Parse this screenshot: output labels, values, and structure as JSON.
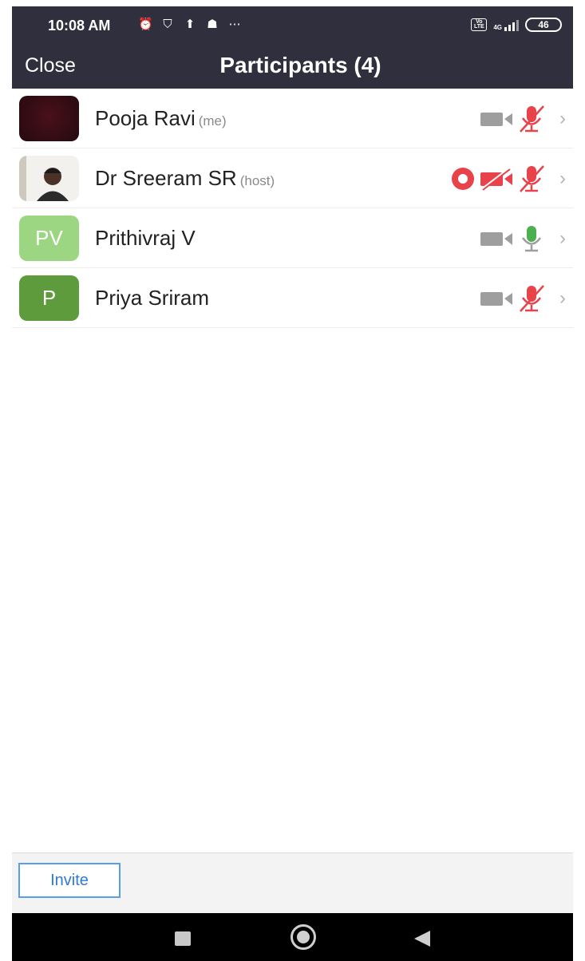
{
  "status": {
    "time": "10:08 AM",
    "volte": "Vo LTE",
    "network": "4G",
    "battery": "46"
  },
  "header": {
    "close_label": "Close",
    "title": "Participants (4)"
  },
  "participants": [
    {
      "name": "Pooja Ravi",
      "role": "(me)",
      "avatar_initials": "",
      "avatar_color": "#3a0d15",
      "video": "off",
      "mic": "muted",
      "recording": false
    },
    {
      "name": "Dr Sreeram SR",
      "role": "(host)",
      "avatar_initials": "",
      "avatar_color": "#d8d2c8",
      "video": "disabled",
      "mic": "muted",
      "recording": true
    },
    {
      "name": "Prithivraj V",
      "role": "",
      "avatar_initials": "PV",
      "avatar_color": "#9dd683",
      "video": "off",
      "mic": "on",
      "recording": false
    },
    {
      "name": "Priya Sriram",
      "role": "",
      "avatar_initials": "P",
      "avatar_color": "#5d9b3c",
      "video": "off",
      "mic": "muted",
      "recording": false
    }
  ],
  "footer": {
    "invite_label": "Invite"
  },
  "colors": {
    "header_bg": "#2f2f3d",
    "muted_red": "#e8424a",
    "mic_green": "#4caf50",
    "invite_blue": "#2e7ad6"
  }
}
